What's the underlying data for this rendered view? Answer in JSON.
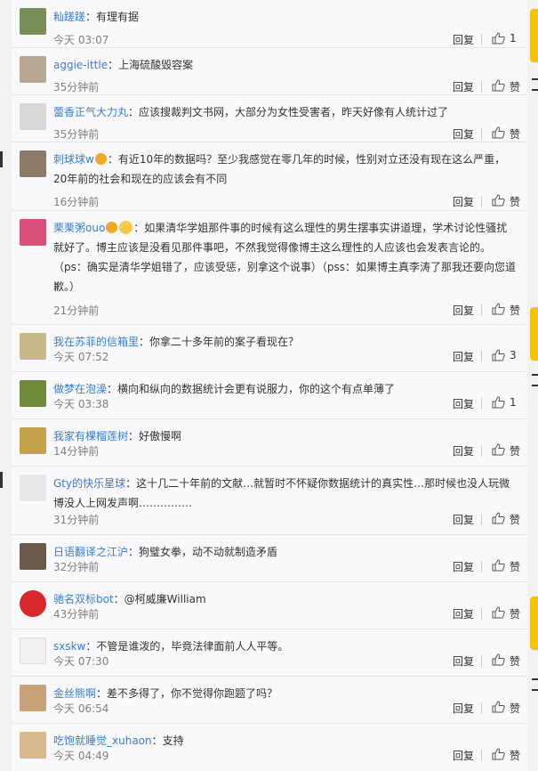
{
  "comments": [
    {
      "user": "籼蹉蹉",
      "text": "：有理有据",
      "time": "今天 03:07",
      "reply": "回复",
      "likes": "1",
      "avatar": "#7a8f5a"
    },
    {
      "user": "aggie-ittle",
      "text": "：上海硫酸毁容案",
      "time": "35分钟前",
      "reply": "回复",
      "likes": "赞",
      "avatar": "#b8a894"
    },
    {
      "user": "蕾香正气大力丸",
      "text": "：应该搜裁判文书网，大部分为女性受害者，昨天好像有人统计过了",
      "time": "35分钟前",
      "reply": "回复",
      "likes": "赞",
      "avatar": "#d9d9d9"
    },
    {
      "user": "刺球球w",
      "text": "：有近10年的数据吗？至少我感觉在零几年的时候，性别对立还没有现在这么严重，20年前的社会和现在的应该会有不同",
      "time": "16分钟前",
      "reply": "回复",
      "likes": "赞",
      "avatar": "#8c7a66"
    },
    {
      "user": "栗栗粥ouo",
      "text": "：如果清华学姐那件事的时候有这么理性的男生摆事实讲道理，学术讨论性骚扰就好了。博主应该是没看见那件事吧，不然我觉得像博主这么理性的人应该也会发表言论的。（ps：确实是清华学姐错了，应该受惩，别拿这个说事）（pss：如果博主真李涛了那我还要向您道歉。）",
      "time": "21分钟前",
      "reply": "回复",
      "likes": "赞",
      "avatar": "#d94f7a"
    },
    {
      "user": "我在苏菲的信箱里",
      "text": "：你拿二十多年前的案子看现在？",
      "time": "今天 07:52",
      "reply": "回复",
      "likes": "3",
      "avatar": "#c9b98a"
    },
    {
      "user": "做梦在泡澡",
      "text": "：横向和纵向的数据统计会更有说服力，你的这个有点单薄了",
      "time": "今天 03:38",
      "reply": "回复",
      "likes": "1",
      "avatar": "#6f8a3a"
    },
    {
      "user": "我家有棵榴莲树",
      "text": "：好傲慢啊",
      "time": "14分钟前",
      "reply": "回复",
      "likes": "赞",
      "avatar": "#c4a24a"
    },
    {
      "user": "Gty的快乐星球",
      "text": "：这十几二十年前的文献…就暂时不怀疑你数据统计的真实性…那时候也没人玩微博没人上网发声啊……………",
      "time": "31分钟前",
      "reply": "回复",
      "likes": "赞",
      "avatar": "#e8e8e8"
    },
    {
      "user": "日语翻译之江沪",
      "text": "：狗璧女拳，动不动就制造矛盾",
      "time": "32分钟前",
      "reply": "回复",
      "likes": "赞",
      "avatar": "#6b5a4a"
    },
    {
      "user": "驰名双标bot",
      "text": "：@柯威廉William",
      "time": "43分钟前",
      "reply": "回复",
      "likes": "赞",
      "avatar": "#d8282e"
    },
    {
      "user": "sxskw",
      "text": "：不管是谁泼的，毕竟法律面前人人平等。",
      "time": "今天 07:30",
      "reply": "回复",
      "likes": "赞",
      "avatar": "#f0f0f0"
    },
    {
      "user": "金丝熊啊",
      "text": "：差不多得了，你不觉得你跑题了吗？",
      "time": "今天 06:54",
      "reply": "回复",
      "likes": "赞",
      "avatar": "#c9a27a"
    },
    {
      "user": "吃饱就睡觉_xuhaon",
      "text": "：支持",
      "time": "今天 04:49",
      "reply": "回复",
      "likes": "赞",
      "avatar": "#d9b88c"
    }
  ]
}
